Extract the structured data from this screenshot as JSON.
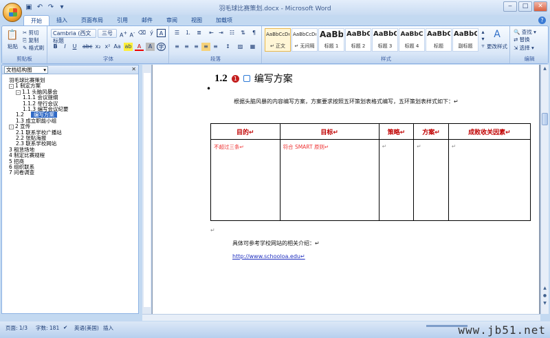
{
  "window": {
    "title": "羽毛球比赛策划.docx - Microsoft Word"
  },
  "tabs": [
    "开始",
    "插入",
    "页面布局",
    "引用",
    "邮件",
    "审阅",
    "视图",
    "加载项"
  ],
  "ribbon": {
    "clipboard": {
      "label": "剪贴板",
      "paste": "粘贴",
      "cut": "剪切",
      "copy": "复制",
      "format_painter": "格式刷"
    },
    "font": {
      "label": "字体",
      "font_name": "Cambria (西文标题",
      "font_size": "三号"
    },
    "paragraph": {
      "label": "段落"
    },
    "styles": {
      "label": "样式",
      "items": [
        {
          "preview": "AaBbCcDd",
          "name": "↵ 正文"
        },
        {
          "preview": "AaBbCcDd",
          "name": "↵ 无间隔"
        },
        {
          "preview": "AaBb",
          "name": "标题 1"
        },
        {
          "preview": "AaBbC",
          "name": "标题 2"
        },
        {
          "preview": "AaBbC",
          "name": "标题 3"
        },
        {
          "preview": "AaBbC",
          "name": "标题 4"
        },
        {
          "preview": "AaBbC",
          "name": "标题"
        },
        {
          "preview": "AaBbC",
          "name": "副标题"
        }
      ],
      "change_styles": "更改样式"
    },
    "editing": {
      "label": "编辑",
      "find": "查找",
      "replace": "替换",
      "select": "选择"
    }
  },
  "nav_pane": {
    "dropdown": "文档结构图",
    "items": [
      {
        "text": "羽毛球比赛策划",
        "level": 0,
        "toggle": ""
      },
      {
        "text": "1 制定方案",
        "level": 0,
        "toggle": "-"
      },
      {
        "text": "1.1       头脑风暴会",
        "level": 1,
        "toggle": "-"
      },
      {
        "text": "1.1.1 会议提纲",
        "level": 2,
        "toggle": ""
      },
      {
        "text": "1.1.2 举行会议",
        "level": 2,
        "toggle": ""
      },
      {
        "text": "1.1.3 编写会议纪要",
        "level": 2,
        "toggle": ""
      },
      {
        "text": "1.2",
        "level": 1,
        "toggle": "",
        "selected_label": "编写方案"
      },
      {
        "text": "1.3 成立职能小组",
        "level": 1,
        "toggle": ""
      },
      {
        "text": "2 宣传",
        "level": 0,
        "toggle": "-"
      },
      {
        "text": "2.1 联系学校广播站",
        "level": 1,
        "toggle": ""
      },
      {
        "text": "2.2 张贴海报",
        "level": 1,
        "toggle": ""
      },
      {
        "text": "2.3 联系学校网站",
        "level": 1,
        "toggle": ""
      },
      {
        "text": "3 租赁场地",
        "level": 0,
        "toggle": ""
      },
      {
        "text": "4 制定比赛规程",
        "level": 0,
        "toggle": ""
      },
      {
        "text": "5 招商",
        "level": 0,
        "toggle": ""
      },
      {
        "text": "6 组织联系",
        "level": 0,
        "toggle": ""
      },
      {
        "text": "7 问卷调查",
        "level": 0,
        "toggle": ""
      }
    ]
  },
  "document": {
    "heading_num": "1.2",
    "heading_badge": "1",
    "heading_text": "编写方案",
    "intro": "根据头脑风暴的内容编写方案，方案要求按照五环策划表格式编写，五环策划表样式如下：↵",
    "table": {
      "headers": [
        "目的↵",
        "目标↵",
        "策略↵",
        "方案↵",
        "成败收关因素↵"
      ],
      "row": [
        "不超过三条↵",
        "符合 SMART 原则↵",
        "↵",
        "↵",
        "↵"
      ]
    },
    "para_mark": "↵",
    "ref_text": "具体可参考学校网站的相关介绍：↵",
    "ref_link": "http://www.schooloa.edu↵"
  },
  "status": {
    "page": "页面: 1/3",
    "words": "字数: 181",
    "lang": "英语(美国)",
    "mode": "插入"
  },
  "watermark": "www.jb51.net"
}
